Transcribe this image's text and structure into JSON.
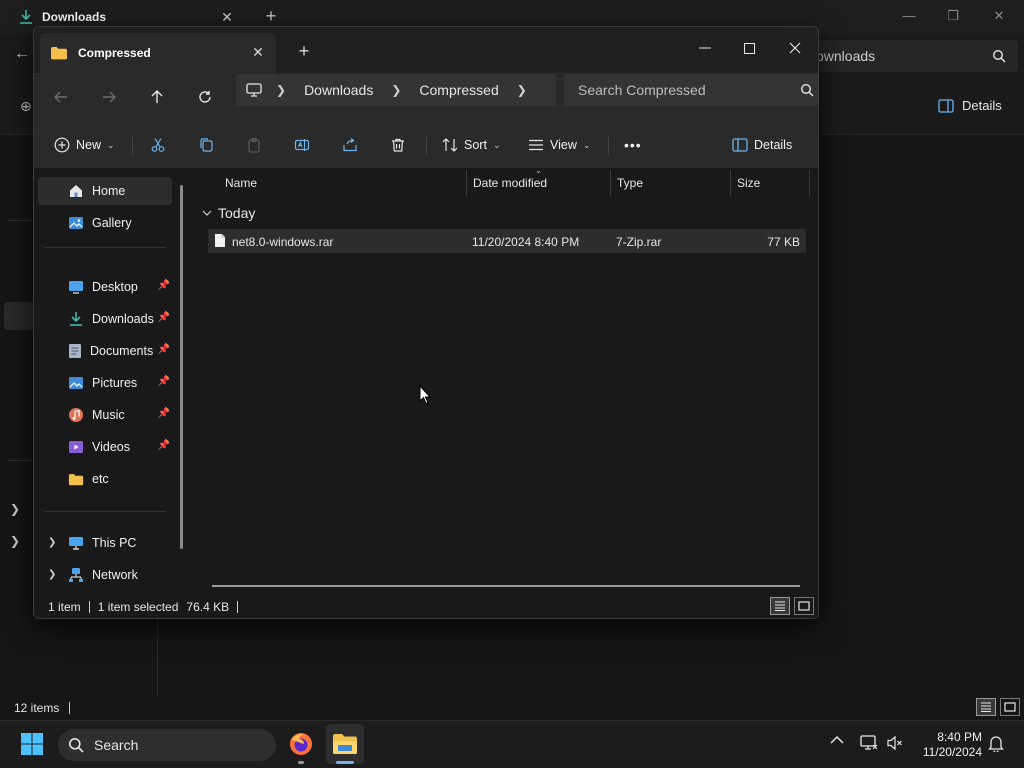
{
  "background_window": {
    "tab_title": "Downloads",
    "search_text": "ownloads",
    "details_label": "Details",
    "status_items": "12 items"
  },
  "window": {
    "tab_title": "Compressed",
    "breadcrumb": [
      "Downloads",
      "Compressed"
    ],
    "search_placeholder": "Search Compressed"
  },
  "command_bar": {
    "new_label": "New",
    "sort_label": "Sort",
    "view_label": "View",
    "more_label": "•••",
    "details_label": "Details"
  },
  "sidebar": {
    "home": "Home",
    "gallery": "Gallery",
    "quick_access": [
      {
        "label": "Desktop",
        "icon": "desktop-icon"
      },
      {
        "label": "Downloads",
        "icon": "download-icon"
      },
      {
        "label": "Documents",
        "icon": "documents-icon"
      },
      {
        "label": "Pictures",
        "icon": "pictures-icon"
      },
      {
        "label": "Music",
        "icon": "music-icon"
      },
      {
        "label": "Videos",
        "icon": "videos-icon"
      },
      {
        "label": "etc",
        "icon": "folder-icon"
      }
    ],
    "this_pc": "This PC",
    "network": "Network"
  },
  "file_list": {
    "columns": [
      "Name",
      "Date modified",
      "Type",
      "Size"
    ],
    "group": "Today",
    "rows": [
      {
        "name": "net8.0-windows.rar",
        "date": "11/20/2024 8:40 PM",
        "type": "7-Zip.rar",
        "size": "77 KB"
      }
    ]
  },
  "status_bar": {
    "count": "1 item",
    "selected": "1 item selected",
    "size": "76.4 KB"
  },
  "taskbar": {
    "search_label": "Search",
    "time": "8:40 PM",
    "date": "11/20/2024"
  },
  "colors": {
    "accent": "#6cb4ee",
    "folder": "#f3c14b",
    "background": "#191919"
  }
}
